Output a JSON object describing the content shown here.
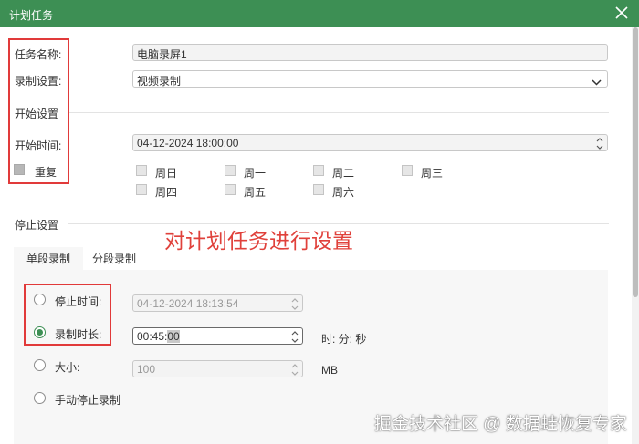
{
  "window": {
    "title": "计划任务"
  },
  "task": {
    "name_label": "任务名称:",
    "name_value": "电脑录屏1",
    "record_label": "录制设置:",
    "record_value": "视频录制"
  },
  "start": {
    "section_label": "开始设置",
    "time_label": "开始时间:",
    "time_value": "04-12-2024 18:00:00",
    "repeat_label": "重复",
    "days": [
      "周日",
      "周一",
      "周二",
      "周三",
      "周四",
      "周五",
      "周六"
    ]
  },
  "stop": {
    "section_label": "停止设置",
    "tabs": [
      "单段录制",
      "分段录制"
    ],
    "stop_time_label": "停止时间:",
    "stop_time_value": "04-12-2024 18:13:54",
    "duration_label": "录制时长:",
    "duration_value_prefix": "00:45:",
    "duration_value_sel": "00",
    "duration_units": "时: 分: 秒",
    "size_label": "大小:",
    "size_value": "100",
    "size_unit": "MB",
    "manual_label": "手动停止录制"
  },
  "annotation": "对计划任务进行设置",
  "watermark": "掘金技术社区 @ 数据蛙恢复专家",
  "colors": {
    "titlebar": "#3d8f54",
    "annotation": "#e0413b"
  }
}
